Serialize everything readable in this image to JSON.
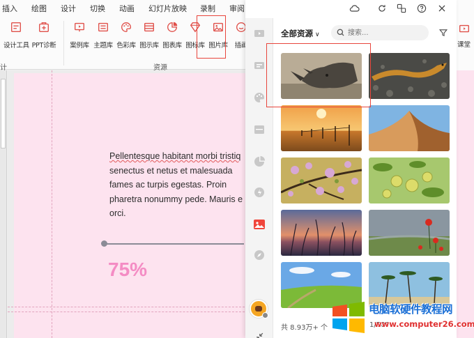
{
  "ribbon": {
    "menu": [
      {
        "label": "插入"
      },
      {
        "label": "绘图"
      },
      {
        "label": "设计"
      },
      {
        "label": "切换"
      },
      {
        "label": "动画"
      },
      {
        "label": "幻灯片放映"
      },
      {
        "label": "录制"
      },
      {
        "label": "审阅"
      }
    ],
    "tools": [
      {
        "label": "设计工具",
        "icon": "design-tools-icon"
      },
      {
        "label": "PPT诊断",
        "icon": "ppt-diagnose-icon"
      },
      {
        "label": "案例库",
        "icon": "case-library-icon"
      },
      {
        "label": "主题库",
        "icon": "theme-library-icon"
      },
      {
        "label": "色彩库",
        "icon": "palette-icon"
      },
      {
        "label": "图示库",
        "icon": "diagram-library-icon"
      },
      {
        "label": "图表库",
        "icon": "chart-library-icon"
      },
      {
        "label": "图标库",
        "icon": "icon-library-icon"
      },
      {
        "label": "图片库",
        "icon": "image-library-icon"
      },
      {
        "label": "插画",
        "icon": "illustration-icon"
      }
    ],
    "group_left_label": "计",
    "group_resources_label": "资源",
    "right_tool_label": "课堂",
    "accent_color": "#e0504a",
    "highlight_color": "#e8453c"
  },
  "slide": {
    "body_lines": [
      "Pellentesque habitant morbi tristiq",
      "senectus et netus et malesuada",
      "fames ac turpis egestas. Proin",
      "pharetra nonummy pede. Mauris e",
      "orci."
    ],
    "percent": "75%",
    "background": "#fde3ef",
    "percent_color": "#f48cc4"
  },
  "pane": {
    "filter_label": "全部资源",
    "search_placeholder": "搜索...",
    "total": "共 8.93万+ 个",
    "page": "1/500",
    "active_color": "#f0453b",
    "side_icons": [
      "video-icon",
      "slides-icon",
      "palette-icon",
      "grid-icon",
      "pie-chart-icon",
      "sticker-icon",
      "image-icon",
      "compass-icon"
    ],
    "images": [
      {
        "subject": "rhino"
      },
      {
        "subject": "snake"
      },
      {
        "subject": "sunset-fence"
      },
      {
        "subject": "desert-dune"
      },
      {
        "subject": "cherry-blossom"
      },
      {
        "subject": "green-fruit"
      },
      {
        "subject": "grass-sunset"
      },
      {
        "subject": "poppies"
      },
      {
        "subject": "green-field"
      },
      {
        "subject": "palm-trees"
      }
    ]
  },
  "watermark": {
    "title": "电脑软硬件教程网",
    "url": "www.computer26.com"
  }
}
